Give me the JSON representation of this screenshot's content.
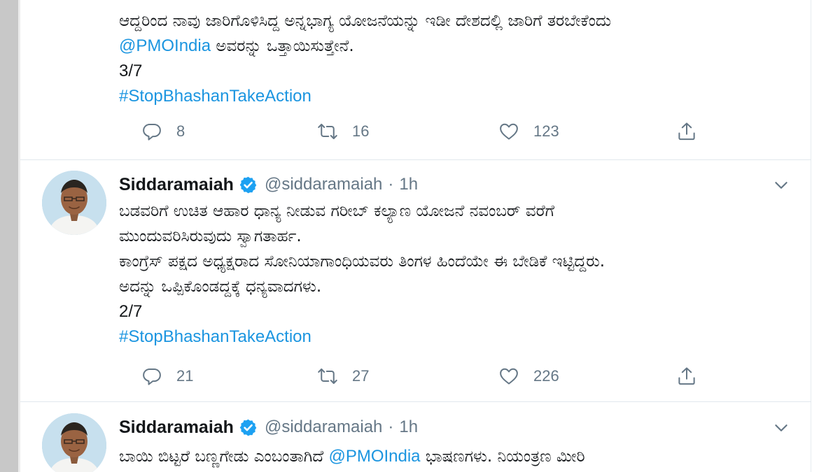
{
  "tweets": [
    {
      "body_lines": [
        {
          "parts": [
            {
              "text": "ಆದ್ದರಿಂದ ನಾವು ಜಾರಿಗೊಳಿಸಿದ್ದ ಅನ್ನಭಾಗ್ಯ ಯೋಜನೆಯನ್ನು ಇಡೀ ದೇಶದಲ್ಲಿ ಜಾರಿಗೆ ತರಬೇಕೆಂದು",
              "link": false
            }
          ]
        },
        {
          "parts": [
            {
              "text": "@PMOIndia",
              "link": true
            },
            {
              "text": " ಅವರನ್ನು ಒತ್ತಾಯಿಸುತ್ತೇನೆ.",
              "link": false
            }
          ]
        },
        {
          "parts": [
            {
              "text": "3/7",
              "link": false
            }
          ]
        },
        {
          "parts": [
            {
              "text": "#StopBhashanTakeAction",
              "link": true
            }
          ]
        }
      ],
      "replies": "8",
      "retweets": "16",
      "likes": "123"
    },
    {
      "author_name": "Siddaramaiah",
      "author_handle": "@siddaramaiah",
      "separator": "·",
      "timestamp": "1h",
      "body_lines": [
        {
          "parts": [
            {
              "text": "ಬಡವರಿಗೆ ಉಚಿತ ಆಹಾರ ಧಾನ್ಯ ನೀಡುವ ಗರೀಬ್ ಕಲ್ಯಾಣ ಯೋಜನೆ ನವಂಬರ್  ವರೆಗೆ",
              "link": false
            }
          ]
        },
        {
          "parts": [
            {
              "text": "ಮುಂದುವರಿಸಿರುವುದು ಸ್ವಾಗತಾರ್ಹ.",
              "link": false
            }
          ]
        },
        {
          "parts": [
            {
              "text": "ಕಾಂಗ್ರೆಸ್ ಪಕ್ಷದ ಅಧ್ಯಕ್ಷರಾದ ಸೋನಿಯಾಗಾಂಧಿಯವರು ತಿಂಗಳ ಹಿಂದೆಯೇ ಈ ಬೇಡಿಕೆ ಇಟ್ಟಿದ್ದರು.",
              "link": false
            }
          ]
        },
        {
          "parts": [
            {
              "text": "ಅದನ್ನು ಒಪ್ಪಿಕೊಂಡದ್ದಕ್ಕೆ ಧನ್ಯವಾದಗಳು.",
              "link": false
            }
          ]
        },
        {
          "parts": [
            {
              "text": "2/7",
              "link": false
            }
          ]
        },
        {
          "parts": [
            {
              "text": "#StopBhashanTakeAction",
              "link": true
            }
          ]
        }
      ],
      "replies": "21",
      "retweets": "27",
      "likes": "226"
    },
    {
      "author_name": "Siddaramaiah",
      "author_handle": "@siddaramaiah",
      "separator": "·",
      "timestamp": "1h",
      "body_lines": [
        {
          "parts": [
            {
              "text": "ಬಾಯಿ ಬಿಟ್ಟರೆ ಬಣ್ಣಗೇಡು ಎಂಬಂತಾಗಿದೆ ",
              "link": false
            },
            {
              "text": "@PMOIndia",
              "link": true
            },
            {
              "text": " ಭಾಷಣಗಳು. ನಿಯಂತ್ರಣ ಮೀರಿ",
              "link": false
            }
          ]
        }
      ]
    }
  ],
  "icons": {
    "reply": "reply-icon",
    "retweet": "retweet-icon",
    "like": "like-icon",
    "share": "share-icon",
    "verified": "verified-badge-icon",
    "more": "chevron-down-icon",
    "avatar": "avatar"
  },
  "colors": {
    "link": "#1b95e0",
    "text": "#14171a",
    "secondary": "#657786",
    "divider": "#e1e8ed",
    "verified": "#1da1f2",
    "rail": "#c8c8c8"
  }
}
